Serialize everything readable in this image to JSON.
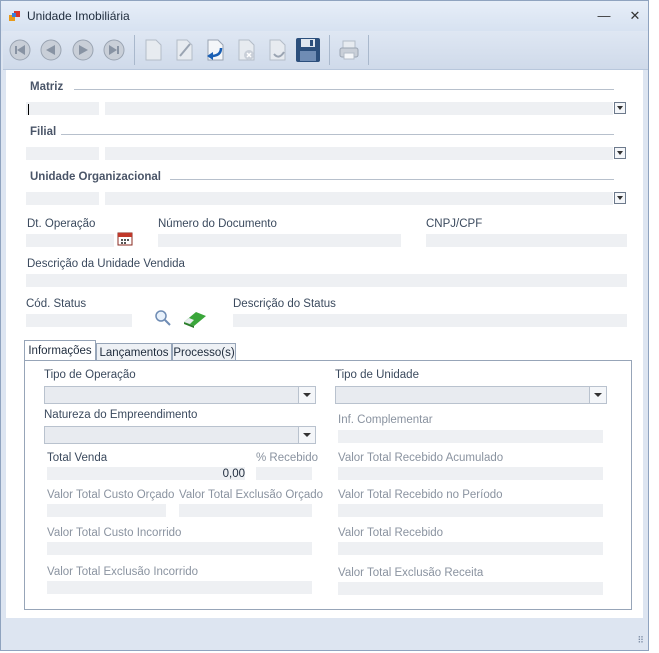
{
  "window": {
    "title": "Unidade Imobiliária",
    "minimize_label": "—",
    "close_label": "✕"
  },
  "toolbar": {
    "buttons": [
      "first-icon",
      "previous-icon",
      "next-icon",
      "last-icon",
      "new-icon",
      "edit-icon",
      "undo-icon",
      "delete-icon",
      "cancel-icon",
      "save-icon",
      "print-icon"
    ]
  },
  "sections": {
    "matriz": "Matriz",
    "filial": "Filial",
    "unidade_org": "Unidade Organizacional"
  },
  "fields": {
    "dt_operacao": "Dt. Operação",
    "numero_documento": "Número do Documento",
    "cnpj_cpf": "CNPJ/CPF",
    "descricao_unidade": "Descrição da Unidade Vendida",
    "cod_status": "Cód. Status",
    "descricao_status": "Descrição do Status"
  },
  "tabs": {
    "informacoes": "Informações",
    "lancamentos": "Lançamentos",
    "processos": "Processo(s)"
  },
  "info": {
    "tipo_operacao": "Tipo de Operação",
    "tipo_unidade": "Tipo de Unidade",
    "natureza": "Natureza do Empreendimento",
    "inf_complementar": "Inf. Complementar",
    "total_venda": "Total Venda",
    "total_venda_value": "0,00",
    "pct_recebido": "% Recebido",
    "vt_recebido_acumulado": "Valor Total Recebido Acumulado",
    "vt_custo_orcado": "Valor Total Custo Orçado",
    "vt_exclusao_orcado": "Valor Total Exclusão Orçado",
    "vt_recebido_periodo": "Valor Total Recebido no Período",
    "vt_custo_incorrido": "Valor Total Custo Incorrido",
    "vt_recebido": "Valor Total Recebido",
    "vt_exclusao_incorrido": "Valor Total Exclusão Incorrido",
    "vt_exclusao_receita": "Valor Total Exclusão Receita"
  },
  "colors": {
    "accent": "#1a5fb4",
    "calendar": "#c0392b",
    "eraser": "#3aa63a"
  }
}
